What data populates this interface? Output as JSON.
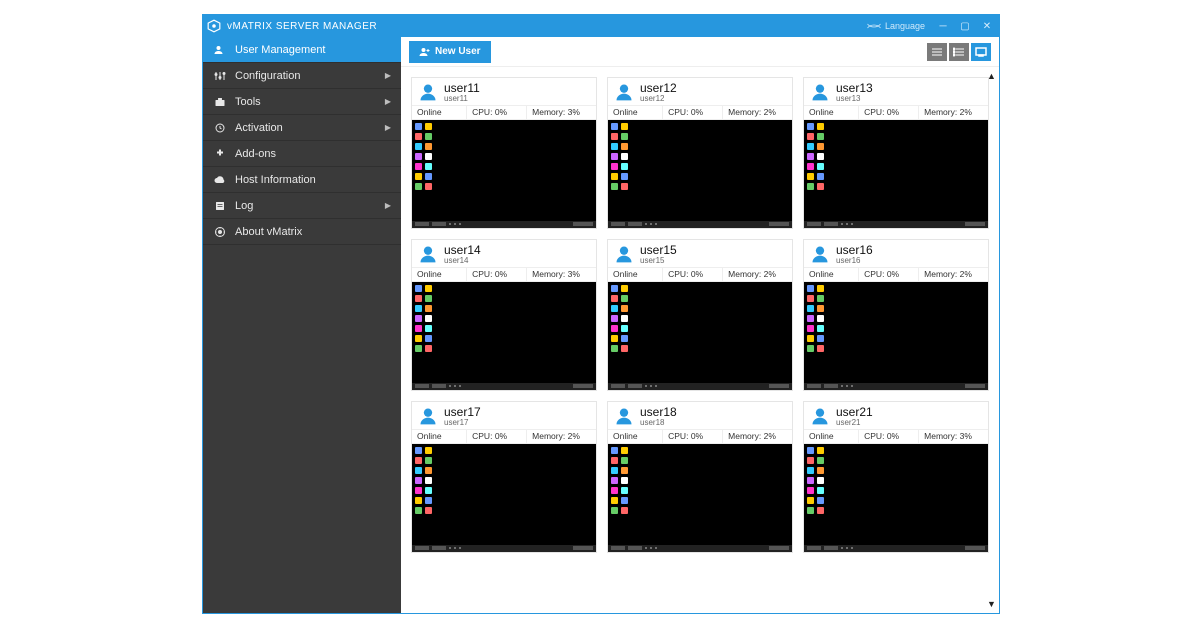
{
  "window": {
    "title": "vMATRIX SERVER MANAGER",
    "language_label": "Language"
  },
  "sidebar": {
    "items": [
      {
        "label": "User Management",
        "has_children": false,
        "active": true
      },
      {
        "label": "Configuration",
        "has_children": true,
        "active": false
      },
      {
        "label": "Tools",
        "has_children": true,
        "active": false
      },
      {
        "label": "Activation",
        "has_children": true,
        "active": false
      },
      {
        "label": "Add-ons",
        "has_children": false,
        "active": false
      },
      {
        "label": "Host Information",
        "has_children": false,
        "active": false
      },
      {
        "label": "Log",
        "has_children": true,
        "active": false
      },
      {
        "label": "About vMatrix",
        "has_children": false,
        "active": false
      }
    ]
  },
  "toolbar": {
    "new_user_label": "New User"
  },
  "labels": {
    "status": "Online",
    "cpu_prefix": "CPU:",
    "mem_prefix": "Memory:"
  },
  "users": [
    {
      "name": "user11",
      "sub": "user11",
      "status": "Online",
      "cpu": "0%",
      "memory": "3%"
    },
    {
      "name": "user12",
      "sub": "user12",
      "status": "Online",
      "cpu": "0%",
      "memory": "2%"
    },
    {
      "name": "user13",
      "sub": "user13",
      "status": "Online",
      "cpu": "0%",
      "memory": "2%"
    },
    {
      "name": "user14",
      "sub": "user14",
      "status": "Online",
      "cpu": "0%",
      "memory": "3%"
    },
    {
      "name": "user15",
      "sub": "user15",
      "status": "Online",
      "cpu": "0%",
      "memory": "2%"
    },
    {
      "name": "user16",
      "sub": "user16",
      "status": "Online",
      "cpu": "0%",
      "memory": "2%"
    },
    {
      "name": "user17",
      "sub": "user17",
      "status": "Online",
      "cpu": "0%",
      "memory": "2%"
    },
    {
      "name": "user18",
      "sub": "user18",
      "status": "Online",
      "cpu": "0%",
      "memory": "2%"
    },
    {
      "name": "user21",
      "sub": "user21",
      "status": "Online",
      "cpu": "0%",
      "memory": "3%"
    }
  ]
}
